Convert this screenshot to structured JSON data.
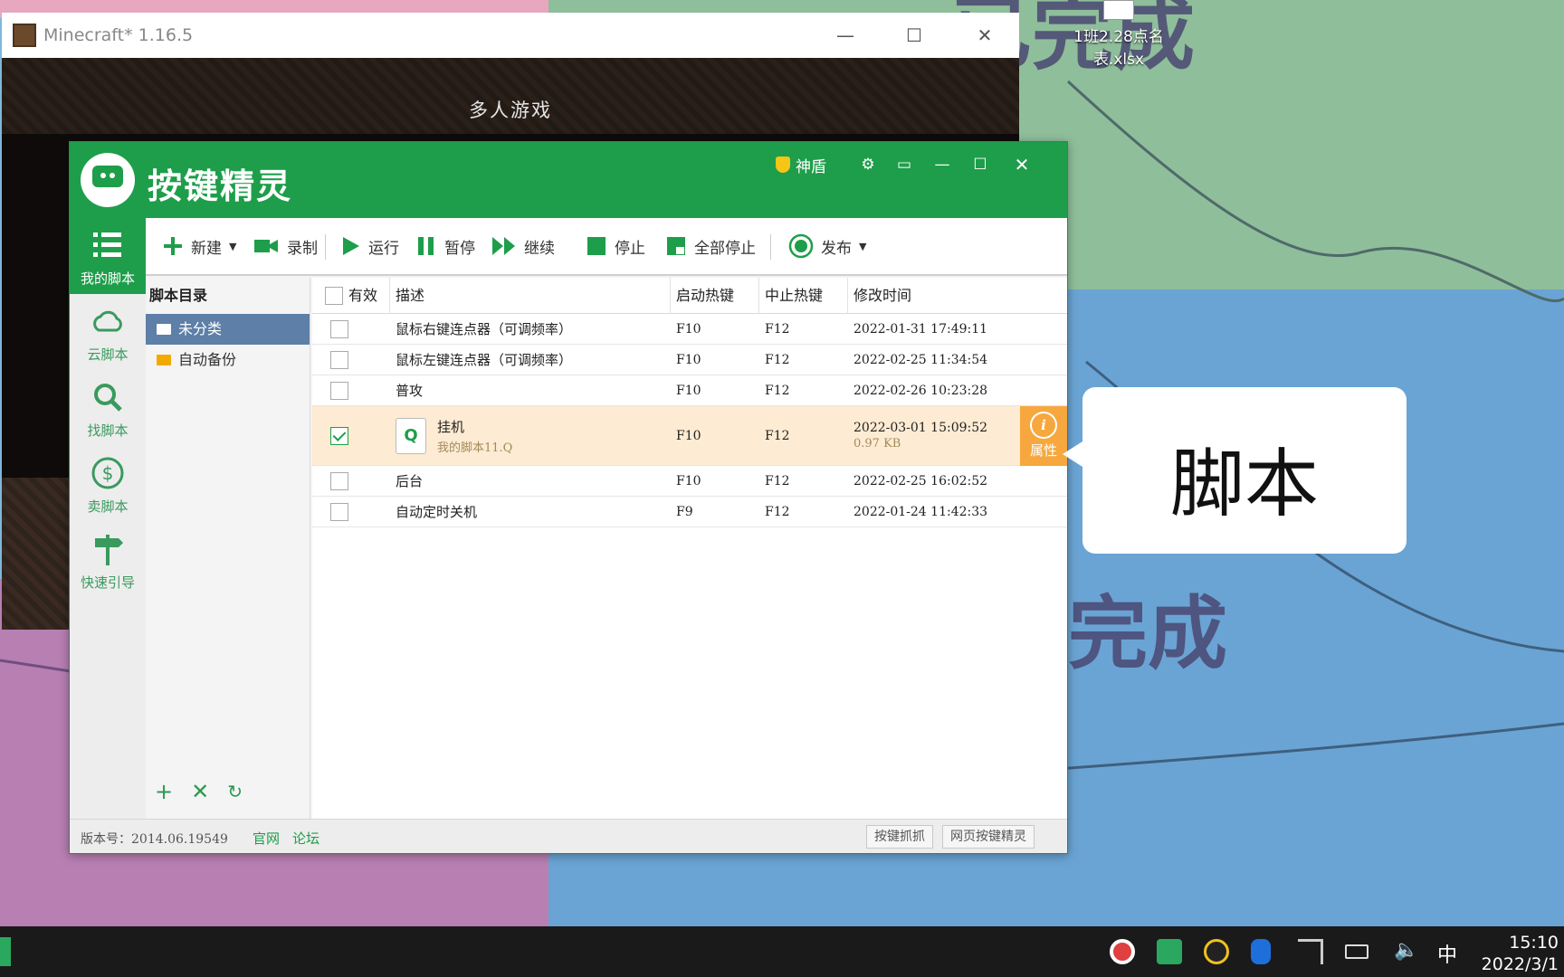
{
  "desktop": {
    "file_label": "1班2.28点名表.xlsx",
    "wall_text_1": "已完成",
    "wall_text_2": "完成"
  },
  "minecraft": {
    "title": "Minecraft* 1.16.5",
    "menu_title": "多人游戏"
  },
  "app": {
    "name": "按键精灵",
    "shield_label": "神盾",
    "nav": [
      {
        "label": "我的脚本"
      },
      {
        "label": "云脚本"
      },
      {
        "label": "找脚本"
      },
      {
        "label": "卖脚本"
      },
      {
        "label": "快速引导"
      }
    ],
    "toolbar": {
      "new": "新建",
      "record": "录制",
      "run": "运行",
      "pause": "暂停",
      "resume": "继续",
      "stop": "停止",
      "stop_all": "全部停止",
      "publish": "发布"
    },
    "dir": {
      "title": "脚本目录",
      "items": [
        "未分类",
        "自动备份"
      ]
    },
    "table": {
      "headers": [
        "有效",
        "描述",
        "启动热键",
        "中止热键",
        "修改时间"
      ],
      "rows": [
        {
          "desc": "鼠标右键连点器（可调频率）",
          "start": "F10",
          "stop": "F12",
          "time": "2022-01-31 17:49:11"
        },
        {
          "desc": "鼠标左键连点器（可调频率）",
          "start": "F10",
          "stop": "F12",
          "time": "2022-02-25 11:34:54"
        },
        {
          "desc": "普攻",
          "start": "F10",
          "stop": "F12",
          "time": "2022-02-26 10:23:28"
        },
        {
          "desc": "挂机",
          "sub": "我的脚本11.Q",
          "start": "F10",
          "stop": "F12",
          "time": "2022-03-01 15:09:52",
          "size": "0.97 KB",
          "prop": "属性",
          "checked": true
        },
        {
          "desc": "后台",
          "start": "F10",
          "stop": "F12",
          "time": "2022-02-25 16:02:52"
        },
        {
          "desc": "自动定时关机",
          "start": "F9",
          "stop": "F12",
          "time": "2022-01-24 11:42:33"
        }
      ]
    },
    "status": {
      "version": "版本号：2014.06.19549",
      "official": "官网",
      "forum": "论坛",
      "btn1": "按键抓抓",
      "btn2": "网页按键精灵"
    }
  },
  "callout": {
    "text": "脚本"
  },
  "taskbar": {
    "ime": "中",
    "time": "15:10",
    "date": "2022/3/1"
  }
}
